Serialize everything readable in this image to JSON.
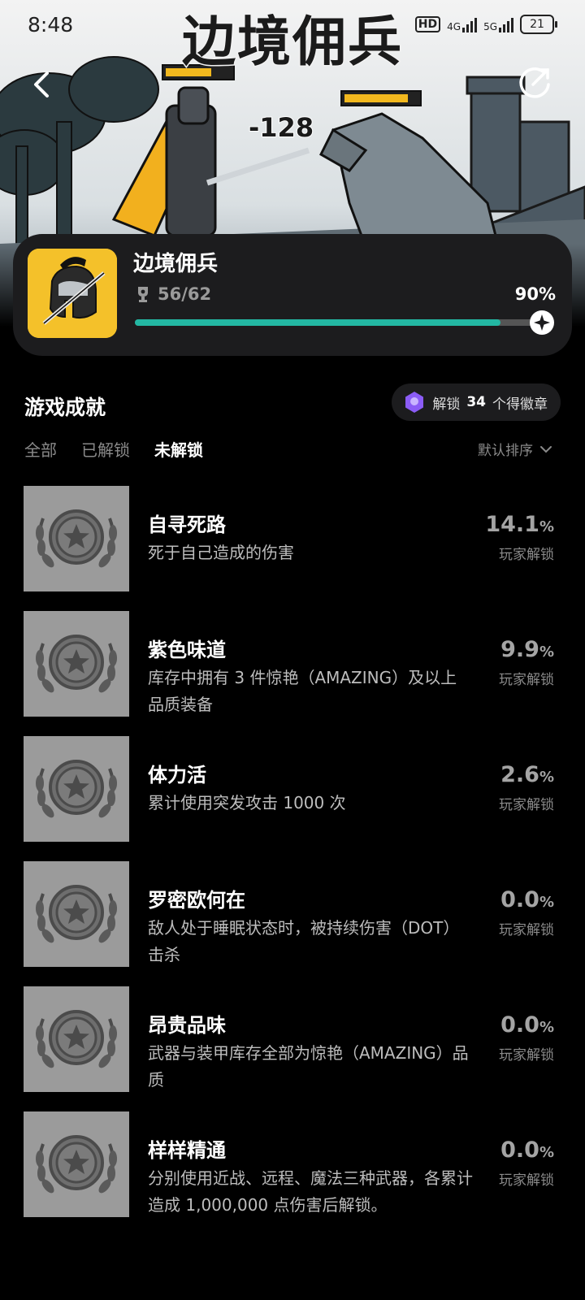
{
  "status_bar": {
    "time": "8:48",
    "hd": "HD",
    "net_4g": "4G",
    "net_5g": "5G",
    "battery": "21"
  },
  "hero": {
    "title": "边境佣兵",
    "damage_text": "-128"
  },
  "game": {
    "name": "边境佣兵",
    "progress_text": "56/62",
    "percent_text": "90%",
    "progress_fraction": 0.9
  },
  "achievements_section": {
    "title": "游戏成就",
    "badge_prefix": "解锁",
    "badge_count": "34",
    "badge_suffix": "个得徽章",
    "tabs": [
      "全部",
      "已解锁",
      "未解锁"
    ],
    "active_tab": "未解锁",
    "sort_label": "默认排序"
  },
  "achievements": [
    {
      "title": "自寻死路",
      "desc": "死于自己造成的伤害",
      "pct": "14.1",
      "pct_unit": "%",
      "sub": "玩家解锁"
    },
    {
      "title": "紫色味道",
      "desc": "库存中拥有 3 件惊艳（AMAZING）及以上品质装备",
      "pct": "9.9",
      "pct_unit": "%",
      "sub": "玩家解锁"
    },
    {
      "title": "体力活",
      "desc": "累计使用突发攻击 1000 次",
      "pct": "2.6",
      "pct_unit": "%",
      "sub": "玩家解锁"
    },
    {
      "title": "罗密欧何在",
      "desc": "敌人处于睡眠状态时，被持续伤害（DOT）击杀",
      "pct": "0.0",
      "pct_unit": "%",
      "sub": "玩家解锁"
    },
    {
      "title": "昂贵品味",
      "desc": "武器与装甲库存全部为惊艳（AMAZING）品质",
      "pct": "0.0",
      "pct_unit": "%",
      "sub": "玩家解锁"
    },
    {
      "title": "样样精通",
      "desc": "分别使用近战、远程、魔法三种武器，各累计造成 1,000,000 点伤害后解锁。",
      "pct": "0.0",
      "pct_unit": "%",
      "sub": "玩家解锁"
    }
  ],
  "colors": {
    "accent": "#23b7a3",
    "card_bg": "#1c1c1e",
    "game_icon_bg": "#f4c12a",
    "badge_icon": "#8b5cf6"
  }
}
